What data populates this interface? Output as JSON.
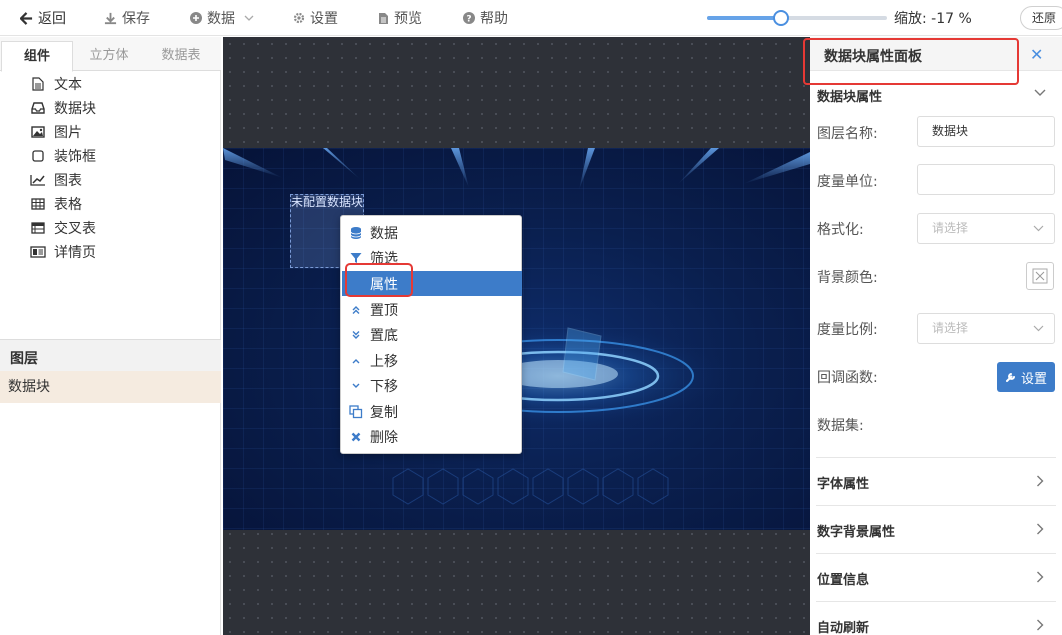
{
  "toolbar": {
    "back": "返回",
    "save": "保存",
    "data": "数据",
    "settings": "设置",
    "preview": "预览",
    "help": "帮助",
    "zoom_label": "缩放: -17 %",
    "zoom_fraction": 0.41,
    "restore": "还原"
  },
  "left": {
    "tabs": [
      "组件",
      "立方体",
      "数据表"
    ],
    "components": [
      {
        "label": "文本",
        "icon": "text-file-icon"
      },
      {
        "label": "数据块",
        "icon": "inbox-icon"
      },
      {
        "label": "图片",
        "icon": "image-icon"
      },
      {
        "label": "装饰框",
        "icon": "frame-icon"
      },
      {
        "label": "图表",
        "icon": "line-chart-icon"
      },
      {
        "label": "表格",
        "icon": "table-icon"
      },
      {
        "label": "交叉表",
        "icon": "crosstab-icon"
      },
      {
        "label": "详情页",
        "icon": "detail-page-icon"
      }
    ],
    "layers_title": "图层",
    "layer_item": "数据块"
  },
  "canvas": {
    "datablock_label": "未配置数据块"
  },
  "context_menu": [
    {
      "label": "数据",
      "icon": "database-icon"
    },
    {
      "label": "筛选",
      "icon": "filter-icon"
    },
    {
      "label": "属性",
      "icon": "",
      "highlighted": true
    },
    {
      "label": "置顶",
      "icon": "double-chevron-up-icon"
    },
    {
      "label": "置底",
      "icon": "double-chevron-down-icon"
    },
    {
      "label": "上移",
      "icon": "chevron-up-icon"
    },
    {
      "label": "下移",
      "icon": "chevron-down-icon"
    },
    {
      "label": "复制",
      "icon": "copy-icon"
    },
    {
      "label": "删除",
      "icon": "delete-x-icon"
    }
  ],
  "right": {
    "title": "数据块属性面板",
    "section_main": "数据块属性",
    "fields": {
      "layer_name_label": "图层名称:",
      "layer_name_value": "数据块",
      "unit_label": "度量单位:",
      "unit_value": "",
      "format_label": "格式化:",
      "format_placeholder": "请选择",
      "bg_color_label": "背景颜色:",
      "ratio_label": "度量比例:",
      "ratio_placeholder": "请选择",
      "callback_label": "回调函数:",
      "callback_button": "设置",
      "dataset_label": "数据集:"
    },
    "sections": [
      "字体属性",
      "数字背景属性",
      "位置信息",
      "自动刷新"
    ]
  },
  "colors": {
    "accent": "#3d7cc9",
    "highlight_box": "#e53935",
    "layer_selected": "#f5ebe0",
    "canvas_bg": "#2e3138",
    "stage_bg": "#0a1f4e"
  }
}
